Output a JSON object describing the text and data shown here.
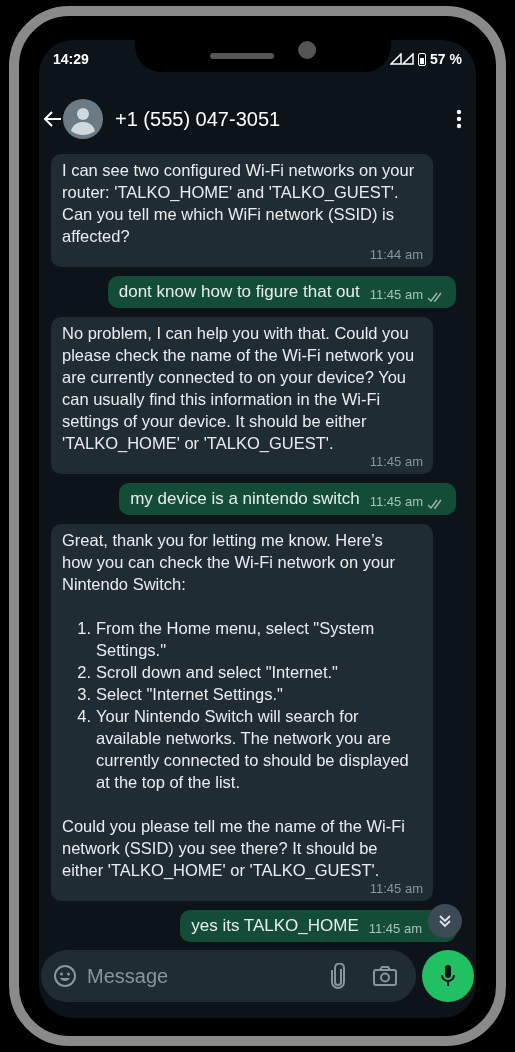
{
  "status_bar": {
    "time": "14:29",
    "battery": "57 %"
  },
  "header": {
    "contact": "+1 (555) 047-3051"
  },
  "messages": [
    {
      "kind": "received",
      "blocks": [
        {
          "kind": "text",
          "text": "I can see two configured Wi-Fi networks on your router: 'TALKO_HOME' and 'TALKO_GUEST'. Can you tell me which WiFi network (SSID) is affected?"
        }
      ],
      "time": "11:44 am"
    },
    {
      "kind": "sent",
      "text": "dont know how to figure that out",
      "time": "11:45 am",
      "read": true
    },
    {
      "kind": "received",
      "blocks": [
        {
          "kind": "text",
          "text": "No problem, I can help you with that. Could you please check the name of the Wi-Fi network you are currently connected to on your device? You can usually find this information in the Wi-Fi settings of your device. It should be either 'TALKO_HOME' or 'TALKO_GUEST'."
        }
      ],
      "time": "11:45 am"
    },
    {
      "kind": "sent",
      "text": "my device is a nintendo switch",
      "time": "11:45 am",
      "read": true
    },
    {
      "kind": "received",
      "blocks": [
        {
          "kind": "text",
          "text": "Great, thank you for letting me know. Here’s how you can check the Wi-Fi network on your Nintendo Switch:"
        },
        {
          "kind": "list",
          "items": [
            {
              "number": "1.",
              "text": "From the Home menu, select \"System Settings.\""
            },
            {
              "number": "2.",
              "text": "Scroll down and select \"Internet.\""
            },
            {
              "number": "3.",
              "text": "Select \"Internet Settings.\""
            },
            {
              "number": "4.",
              "text": "Your Nintendo Switch will search for available networks. The network you are currently connected to should be displayed at the top of the list."
            }
          ]
        },
        {
          "kind": "text",
          "text": "Could you please tell me the name of the Wi-Fi network (SSID) you see there? It should be either 'TALKO_HOME' or 'TALKO_GUEST'."
        }
      ],
      "time": "11:45 am"
    },
    {
      "kind": "sent",
      "text": "yes its TALKO_HOME",
      "time": "11:45 am",
      "read": false
    }
  ],
  "composer": {
    "placeholder": "Message"
  }
}
